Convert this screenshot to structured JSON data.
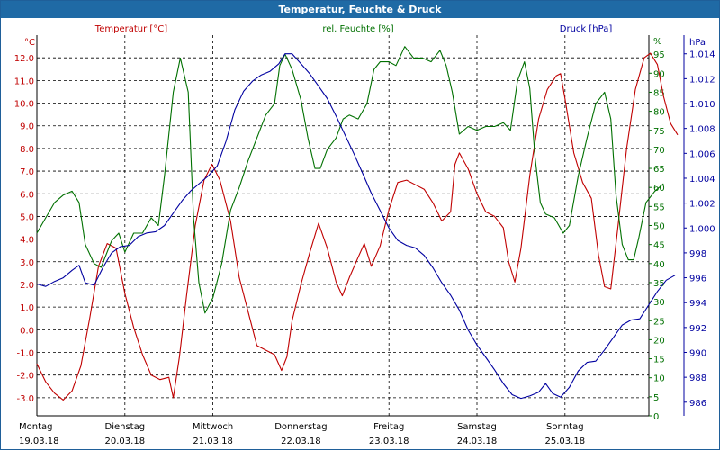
{
  "window": {
    "title": "Temperatur, Feuchte & Druck"
  },
  "colors": {
    "temperature": "#c00000",
    "humidity": "#007000",
    "pressure": "#0000a0",
    "title_bar": "#1f6aa5",
    "grid": "#000000"
  },
  "chart_data": {
    "type": "line",
    "title": "Temperatur, Feuchte & Druck",
    "legend_placement": "top",
    "grid": true,
    "x_range": [
      0,
      7.1
    ],
    "x_ticks": [
      {
        "day": "Montag",
        "date": "19.03.18"
      },
      {
        "day": "Dienstag",
        "date": "20.03.18"
      },
      {
        "day": "Mittwoch",
        "date": "21.03.18"
      },
      {
        "day": "Donnerstag",
        "date": "22.03.18"
      },
      {
        "day": "Freitag",
        "date": "23.03.18"
      },
      {
        "day": "Samstag",
        "date": "24.03.18"
      },
      {
        "day": "Sonntag",
        "date": "25.03.18"
      }
    ],
    "axes": {
      "temperature": {
        "label": "Temperatur [°C]",
        "unit": "°C",
        "range": [
          -3.8,
          13.0
        ],
        "ticks": [
          "12.0",
          "11.0",
          "10.0",
          "9.0",
          "8.0",
          "7.0",
          "6.0",
          "5.0",
          "4.0",
          "3.0",
          "2.0",
          "1.0",
          "0.0",
          "-1.0",
          "-2.0",
          "-3.0"
        ]
      },
      "humidity": {
        "label": "rel. Feuchte [%]",
        "unit": "%",
        "range": [
          0,
          100
        ],
        "ticks": [
          "95",
          "90",
          "85",
          "80",
          "75",
          "70",
          "65",
          "60",
          "55",
          "50",
          "45",
          "40",
          "35",
          "30",
          "25",
          "20",
          "15",
          "10",
          "5",
          "0"
        ]
      },
      "pressure": {
        "label": "Druck [hPa]",
        "unit": "hPa",
        "range": [
          984.9,
          1015.5
        ],
        "ticks": [
          "1.014",
          "1.012",
          "1.010",
          "1.008",
          "1.006",
          "1.004",
          "1.002",
          "1.000",
          "998",
          "996",
          "994",
          "992",
          "990",
          "988",
          "986"
        ]
      }
    },
    "series": [
      {
        "name": "Temperatur [°C]",
        "axis": "temperature",
        "points": [
          [
            0,
            -1.5
          ],
          [
            0.1,
            -2.3
          ],
          [
            0.2,
            -2.8
          ],
          [
            0.3,
            -3.1
          ],
          [
            0.4,
            -2.7
          ],
          [
            0.5,
            -1.6
          ],
          [
            0.6,
            0.5
          ],
          [
            0.7,
            2.8
          ],
          [
            0.8,
            3.8
          ],
          [
            0.9,
            3.6
          ],
          [
            1.0,
            1.6
          ],
          [
            1.1,
            0.1
          ],
          [
            1.2,
            -1.1
          ],
          [
            1.3,
            -2.0
          ],
          [
            1.4,
            -2.2
          ],
          [
            1.5,
            -2.1
          ],
          [
            1.55,
            -3.0
          ],
          [
            1.62,
            -1.2
          ],
          [
            1.7,
            1.5
          ],
          [
            1.8,
            4.6
          ],
          [
            1.9,
            6.6
          ],
          [
            1.99,
            7.3
          ],
          [
            2.08,
            6.6
          ],
          [
            2.2,
            4.8
          ],
          [
            2.3,
            2.3
          ],
          [
            2.4,
            0.8
          ],
          [
            2.5,
            -0.7
          ],
          [
            2.6,
            -0.9
          ],
          [
            2.7,
            -1.1
          ],
          [
            2.78,
            -1.8
          ],
          [
            2.84,
            -1.2
          ],
          [
            2.9,
            0.4
          ],
          [
            3.0,
            2.0
          ],
          [
            3.1,
            3.4
          ],
          [
            3.2,
            4.7
          ],
          [
            3.3,
            3.6
          ],
          [
            3.4,
            2.1
          ],
          [
            3.47,
            1.5
          ],
          [
            3.55,
            2.3
          ],
          [
            3.65,
            3.2
          ],
          [
            3.72,
            3.8
          ],
          [
            3.8,
            2.8
          ],
          [
            3.9,
            3.7
          ],
          [
            4.0,
            5.3
          ],
          [
            4.1,
            6.5
          ],
          [
            4.2,
            6.6
          ],
          [
            4.3,
            6.4
          ],
          [
            4.4,
            6.2
          ],
          [
            4.5,
            5.6
          ],
          [
            4.6,
            4.8
          ],
          [
            4.7,
            5.2
          ],
          [
            4.75,
            7.3
          ],
          [
            4.8,
            7.8
          ],
          [
            4.9,
            7.1
          ],
          [
            5.0,
            6.0
          ],
          [
            5.1,
            5.2
          ],
          [
            5.2,
            5.0
          ],
          [
            5.3,
            4.5
          ],
          [
            5.36,
            3.0
          ],
          [
            5.43,
            2.1
          ],
          [
            5.5,
            3.6
          ],
          [
            5.6,
            6.8
          ],
          [
            5.7,
            9.3
          ],
          [
            5.8,
            10.6
          ],
          [
            5.9,
            11.2
          ],
          [
            5.95,
            11.3
          ],
          [
            6.0,
            10.2
          ],
          [
            6.1,
            7.8
          ],
          [
            6.2,
            6.5
          ],
          [
            6.3,
            5.8
          ],
          [
            6.38,
            3.3
          ],
          [
            6.45,
            1.9
          ],
          [
            6.52,
            1.8
          ],
          [
            6.6,
            4.5
          ],
          [
            6.7,
            8.0
          ],
          [
            6.8,
            10.6
          ],
          [
            6.9,
            12.0
          ],
          [
            6.97,
            12.2
          ],
          [
            7.05,
            11.7
          ],
          [
            7.12,
            10.3
          ],
          [
            7.2,
            9.1
          ],
          [
            7.28,
            8.6
          ]
        ]
      },
      {
        "name": "rel. Feuchte [%]",
        "axis": "humidity",
        "points": [
          [
            0,
            48
          ],
          [
            0.1,
            52
          ],
          [
            0.2,
            56
          ],
          [
            0.3,
            58
          ],
          [
            0.4,
            59
          ],
          [
            0.48,
            56
          ],
          [
            0.55,
            45
          ],
          [
            0.65,
            40
          ],
          [
            0.73,
            39
          ],
          [
            0.85,
            46
          ],
          [
            0.93,
            48
          ],
          [
            1.0,
            43
          ],
          [
            1.1,
            48
          ],
          [
            1.2,
            48
          ],
          [
            1.3,
            52
          ],
          [
            1.38,
            50
          ],
          [
            1.45,
            63
          ],
          [
            1.55,
            85
          ],
          [
            1.63,
            94
          ],
          [
            1.72,
            85
          ],
          [
            1.78,
            52
          ],
          [
            1.84,
            35
          ],
          [
            1.91,
            27
          ],
          [
            2.0,
            31
          ],
          [
            2.1,
            40
          ],
          [
            2.2,
            54
          ],
          [
            2.3,
            60
          ],
          [
            2.4,
            67
          ],
          [
            2.5,
            73
          ],
          [
            2.6,
            79
          ],
          [
            2.7,
            82
          ],
          [
            2.76,
            92
          ],
          [
            2.82,
            95
          ],
          [
            2.9,
            91
          ],
          [
            3.0,
            83
          ],
          [
            3.08,
            73
          ],
          [
            3.16,
            65
          ],
          [
            3.22,
            65
          ],
          [
            3.3,
            70
          ],
          [
            3.4,
            73
          ],
          [
            3.48,
            78
          ],
          [
            3.55,
            79
          ],
          [
            3.65,
            78
          ],
          [
            3.75,
            82
          ],
          [
            3.83,
            91
          ],
          [
            3.9,
            93
          ],
          [
            4.0,
            93
          ],
          [
            4.08,
            92
          ],
          [
            4.18,
            97
          ],
          [
            4.28,
            94
          ],
          [
            4.38,
            94
          ],
          [
            4.48,
            93
          ],
          [
            4.58,
            96
          ],
          [
            4.65,
            92
          ],
          [
            4.72,
            85
          ],
          [
            4.8,
            74
          ],
          [
            4.9,
            76
          ],
          [
            5.0,
            75
          ],
          [
            5.1,
            76
          ],
          [
            5.2,
            76
          ],
          [
            5.3,
            77
          ],
          [
            5.38,
            75
          ],
          [
            5.46,
            88
          ],
          [
            5.54,
            93
          ],
          [
            5.6,
            86
          ],
          [
            5.66,
            68
          ],
          [
            5.72,
            56
          ],
          [
            5.78,
            53
          ],
          [
            5.88,
            52
          ],
          [
            5.98,
            48
          ],
          [
            6.05,
            50
          ],
          [
            6.15,
            63
          ],
          [
            6.25,
            73
          ],
          [
            6.35,
            82
          ],
          [
            6.45,
            85
          ],
          [
            6.52,
            78
          ],
          [
            6.58,
            58
          ],
          [
            6.65,
            45
          ],
          [
            6.72,
            41
          ],
          [
            6.78,
            41
          ],
          [
            6.84,
            47
          ],
          [
            6.92,
            56
          ],
          [
            7.02,
            59
          ],
          [
            7.12,
            61
          ]
        ]
      },
      {
        "name": "Druck [hPa]",
        "axis": "pressure",
        "points": [
          [
            0,
            995.5
          ],
          [
            0.1,
            995.3
          ],
          [
            0.2,
            995.7
          ],
          [
            0.3,
            996.0
          ],
          [
            0.4,
            996.6
          ],
          [
            0.48,
            997.0
          ],
          [
            0.55,
            995.6
          ],
          [
            0.65,
            995.4
          ],
          [
            0.75,
            996.8
          ],
          [
            0.85,
            998.0
          ],
          [
            0.95,
            998.5
          ],
          [
            1.05,
            998.6
          ],
          [
            1.15,
            999.3
          ],
          [
            1.25,
            999.6
          ],
          [
            1.35,
            999.7
          ],
          [
            1.45,
            1000.2
          ],
          [
            1.55,
            1001.2
          ],
          [
            1.65,
            1002.2
          ],
          [
            1.75,
            1003.0
          ],
          [
            1.85,
            1003.6
          ],
          [
            1.95,
            1004.2
          ],
          [
            2.05,
            1005.0
          ],
          [
            2.15,
            1007.0
          ],
          [
            2.25,
            1009.5
          ],
          [
            2.35,
            1011.0
          ],
          [
            2.45,
            1011.8
          ],
          [
            2.55,
            1012.3
          ],
          [
            2.65,
            1012.6
          ],
          [
            2.75,
            1013.2
          ],
          [
            2.82,
            1014.0
          ],
          [
            2.9,
            1014.0
          ],
          [
            3.0,
            1013.2
          ],
          [
            3.1,
            1012.4
          ],
          [
            3.2,
            1011.4
          ],
          [
            3.3,
            1010.4
          ],
          [
            3.4,
            1009.0
          ],
          [
            3.5,
            1007.5
          ],
          [
            3.6,
            1006.0
          ],
          [
            3.7,
            1004.4
          ],
          [
            3.8,
            1002.8
          ],
          [
            3.9,
            1001.4
          ],
          [
            4.0,
            1000.0
          ],
          [
            4.1,
            999.0
          ],
          [
            4.2,
            998.6
          ],
          [
            4.3,
            998.4
          ],
          [
            4.4,
            997.8
          ],
          [
            4.5,
            996.8
          ],
          [
            4.6,
            995.6
          ],
          [
            4.7,
            994.6
          ],
          [
            4.8,
            993.4
          ],
          [
            4.9,
            991.8
          ],
          [
            5.0,
            990.6
          ],
          [
            5.1,
            989.6
          ],
          [
            5.2,
            988.6
          ],
          [
            5.3,
            987.5
          ],
          [
            5.4,
            986.6
          ],
          [
            5.5,
            986.3
          ],
          [
            5.6,
            986.5
          ],
          [
            5.7,
            986.8
          ],
          [
            5.78,
            987.5
          ],
          [
            5.86,
            986.7
          ],
          [
            5.95,
            986.4
          ],
          [
            6.05,
            987.2
          ],
          [
            6.15,
            988.5
          ],
          [
            6.25,
            989.2
          ],
          [
            6.35,
            989.3
          ],
          [
            6.45,
            990.2
          ],
          [
            6.55,
            991.2
          ],
          [
            6.65,
            992.2
          ],
          [
            6.75,
            992.6
          ],
          [
            6.85,
            992.7
          ],
          [
            6.95,
            993.8
          ],
          [
            7.05,
            994.9
          ],
          [
            7.15,
            995.8
          ],
          [
            7.25,
            996.2
          ]
        ]
      }
    ]
  }
}
